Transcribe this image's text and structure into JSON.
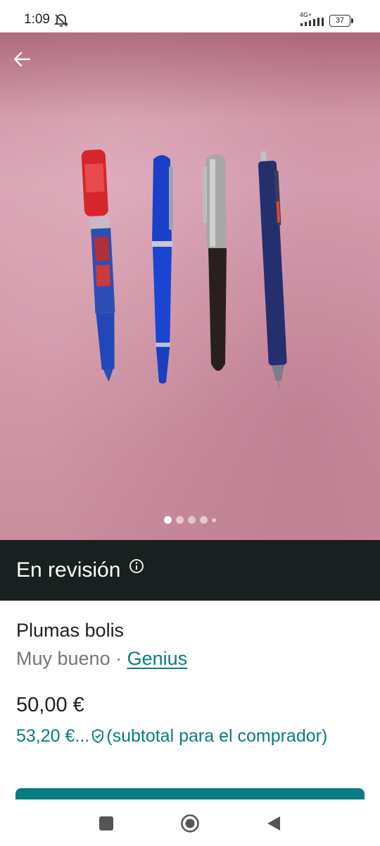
{
  "status_bar": {
    "time": "1:09",
    "network": "4G+",
    "battery": "37",
    "icons": [
      "mute-icon",
      "signal-icon",
      "battery-icon"
    ]
  },
  "gallery": {
    "photo_count": 5,
    "active_index": 0,
    "back_icon": "arrow-left-icon"
  },
  "review_banner": {
    "text": "En revisión",
    "icon": "info-icon"
  },
  "item": {
    "title": "Plumas bolis",
    "condition": "Muy bueno",
    "separator": " · ",
    "brand": "Genius",
    "price": "50,00 €",
    "buyer_price": "53,20 €...",
    "buyer_note": "(subtotal para el comprador)"
  },
  "colors": {
    "accent": "#0a7b80",
    "banner_bg": "#182020",
    "photo_bg": "#d49aab"
  },
  "nav_bar": {
    "icons": [
      "recents-square-icon",
      "home-circle-icon",
      "back-triangle-icon"
    ]
  }
}
